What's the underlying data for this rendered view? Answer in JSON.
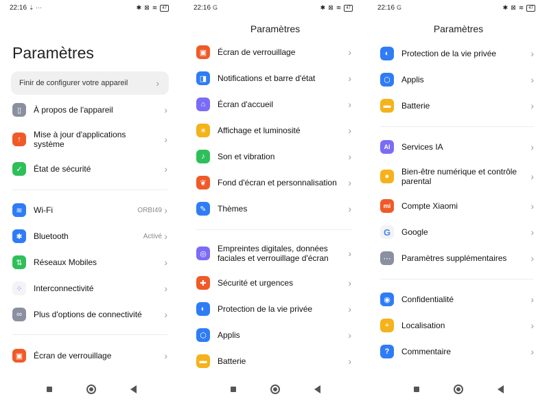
{
  "status": {
    "s1": {
      "time": "22:16",
      "extra": "⇣ ···"
    },
    "s2": {
      "time": "22:16",
      "extra": "G"
    },
    "s3": {
      "time": "22:16",
      "extra": "G"
    },
    "battery": "47"
  },
  "screen1": {
    "title": "Paramètres",
    "setup": "Finir de configurer votre appareil",
    "items": [
      {
        "label": "À propos de l'appareil"
      },
      {
        "label": "Mise à jour d'applications système"
      },
      {
        "label": "État de sécurité"
      },
      {
        "label": "Wi-Fi",
        "value": "ORBI49"
      },
      {
        "label": "Bluetooth",
        "value": "Activé"
      },
      {
        "label": "Réseaux Mobiles"
      },
      {
        "label": "Interconnectivité"
      },
      {
        "label": "Plus d'options de connectivité"
      },
      {
        "label": "Écran de verrouillage"
      }
    ]
  },
  "screen2": {
    "title": "Paramètres",
    "items": [
      {
        "label": "Écran de verrouillage"
      },
      {
        "label": "Notifications et barre d'état"
      },
      {
        "label": "Écran d'accueil"
      },
      {
        "label": "Affichage et luminosité"
      },
      {
        "label": "Son et vibration"
      },
      {
        "label": "Fond d'écran et personnalisation"
      },
      {
        "label": "Thèmes"
      },
      {
        "label": "Empreintes digitales, données faciales et verrouillage d'écran"
      },
      {
        "label": "Sécurité et urgences"
      },
      {
        "label": "Protection de la vie privée"
      },
      {
        "label": "Applis"
      },
      {
        "label": "Batterie"
      }
    ]
  },
  "screen3": {
    "title": "Paramètres",
    "items": [
      {
        "label": "Protection de la vie privée"
      },
      {
        "label": "Applis"
      },
      {
        "label": "Batterie"
      },
      {
        "label": "Services IA"
      },
      {
        "label": "Bien-être numérique et contrôle parental"
      },
      {
        "label": "Compte Xiaomi"
      },
      {
        "label": "Google"
      },
      {
        "label": "Paramètres supplémentaires"
      },
      {
        "label": "Confidentialité"
      },
      {
        "label": "Localisation"
      },
      {
        "label": "Commentaire"
      }
    ]
  }
}
